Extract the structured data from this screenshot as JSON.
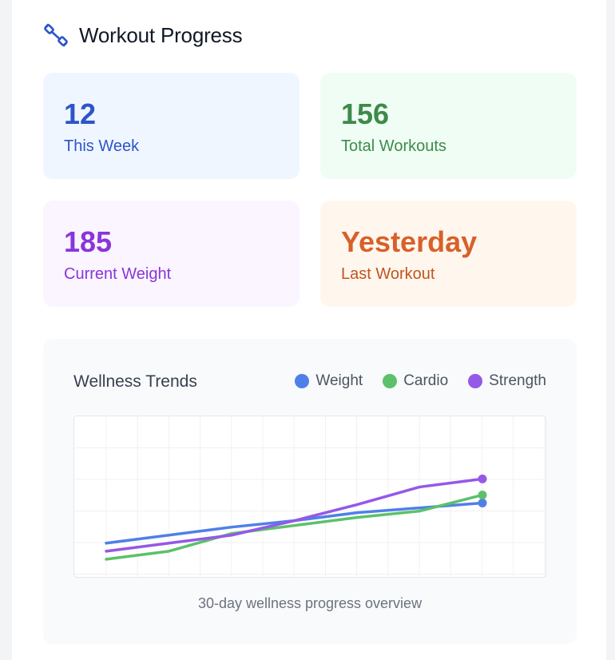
{
  "header": {
    "title": "Workout Progress",
    "icon": "dumbbell-icon"
  },
  "stats": [
    {
      "value": "12",
      "label": "This Week",
      "color": "#2d55c9"
    },
    {
      "value": "156",
      "label": "Total Workouts",
      "color": "#3d8b4a"
    },
    {
      "value": "185",
      "label": "Current Weight",
      "color": "#8a35d9"
    },
    {
      "value": "Yesterday",
      "label": "Last Workout",
      "color": "#d8602a"
    }
  ],
  "chart_card": {
    "title": "Wellness Trends",
    "caption": "30-day wellness progress overview"
  },
  "chart_data": {
    "type": "line",
    "title": "Wellness Trends",
    "xlabel": "",
    "ylabel": "",
    "grid": true,
    "legend_position": "top-right",
    "x": [
      0,
      1,
      2,
      3,
      4,
      5,
      6
    ],
    "ylim": [
      0,
      100
    ],
    "series": [
      {
        "name": "Weight",
        "color": "#4f80e8",
        "values": [
          21,
          26,
          31,
          35,
          40,
          43,
          46
        ]
      },
      {
        "name": "Cardio",
        "color": "#5cc16a",
        "values": [
          11,
          16,
          27,
          32,
          37,
          41,
          51
        ]
      },
      {
        "name": "Strength",
        "color": "#9558e8",
        "values": [
          16,
          21,
          26,
          35,
          45,
          56,
          61
        ]
      }
    ]
  }
}
